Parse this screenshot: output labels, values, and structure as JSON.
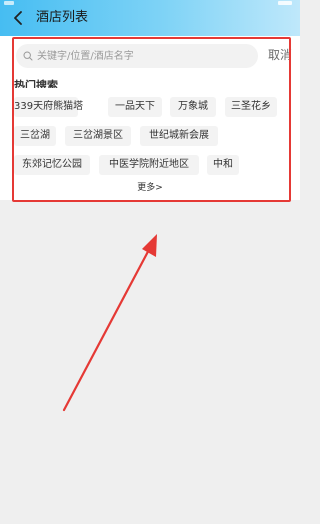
{
  "header": {
    "title": "酒店列表",
    "back_icon": "chevron-left-icon"
  },
  "search": {
    "placeholder": "关键字/位置/酒店名字",
    "value": "",
    "icon": "search-icon",
    "cancel_label": "取消"
  },
  "hot_search": {
    "title": "热门搜索",
    "tags": [
      "339天府熊猫塔",
      "一品天下",
      "万象城",
      "三圣花乡",
      "三岔湖",
      "三岔湖景区",
      "世纪城新会展",
      "东郊记忆公园",
      "中医学院附近地区",
      "中和"
    ],
    "more_label": "更多>"
  },
  "colors": {
    "header_gradient_start": "#46bdf2",
    "header_gradient_end": "#bfe8fb",
    "annotation_red": "#e53935",
    "background": "#efefef"
  }
}
